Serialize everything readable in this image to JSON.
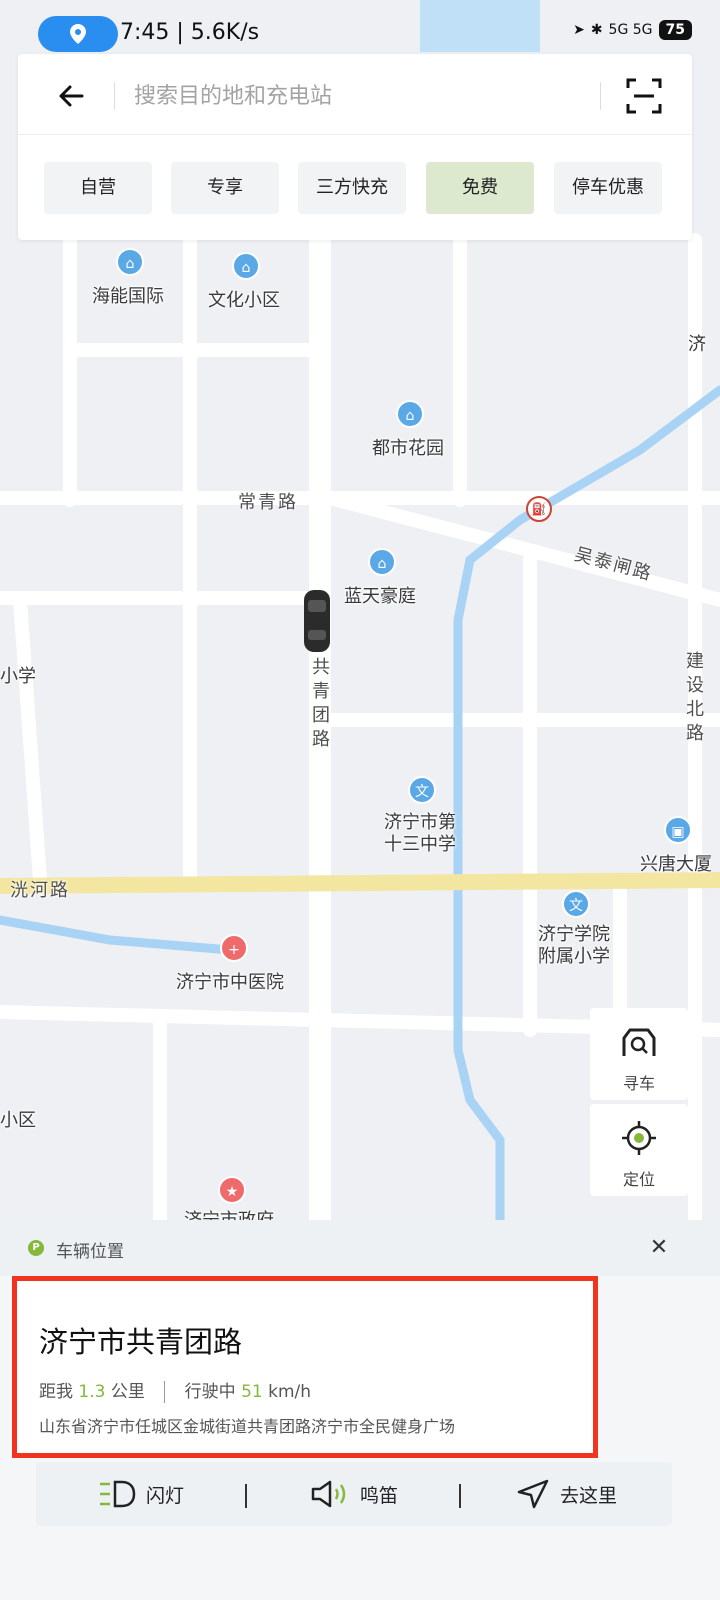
{
  "status_bar": {
    "time": "7:45 | 5.6K/s",
    "network": "5G 5G",
    "battery": "75"
  },
  "search": {
    "placeholder": "搜索目的地和充电站"
  },
  "filters": [
    {
      "label": "自营",
      "active": false
    },
    {
      "label": "专享",
      "active": false
    },
    {
      "label": "三方快充",
      "active": false
    },
    {
      "label": "免费",
      "active": true
    },
    {
      "label": "停车优惠",
      "active": false
    }
  ],
  "map": {
    "pois": {
      "haineng": "海能国际",
      "wenhua": "文化小区",
      "dushi": "都市花园",
      "lantian": "蓝天豪庭",
      "school13": "济宁市第\n十三中学",
      "xingtang": "兴唐大厦",
      "xueyuan": "济宁学院\n附属小学",
      "hospital": "济宁市中医院",
      "gov": "济宁市政府",
      "edge_ji": "济",
      "edge_xiaoxue": "小学",
      "edge_qu": "小区"
    },
    "roads": {
      "changqing": "常青路",
      "wutai": "吴泰闸路",
      "gongqingtuan": "共\n青\n团\n路",
      "guanghe": "洸河路",
      "jianshe": "建\n设\n北\n路"
    }
  },
  "controls": {
    "find_car": "寻车",
    "locate": "定位"
  },
  "vehicle": {
    "section_title": "车辆位置",
    "place_name": "济宁市共青团路",
    "distance_prefix": "距我",
    "distance_value": "1.3",
    "distance_unit": "公里",
    "status_prefix": "行驶中",
    "speed_value": "51",
    "speed_unit": "km/h",
    "address": "山东省济宁市任城区金城街道共青团路济宁市全民健身广场"
  },
  "actions": {
    "flash": "闪灯",
    "horn": "鸣笛",
    "navigate": "去这里"
  },
  "colors": {
    "accent_green": "#86b83c",
    "active_chip": "#dde9cf",
    "highlight_border": "#f0341f",
    "river": "#a9d3f5",
    "main_road": "#f3e6a0"
  }
}
